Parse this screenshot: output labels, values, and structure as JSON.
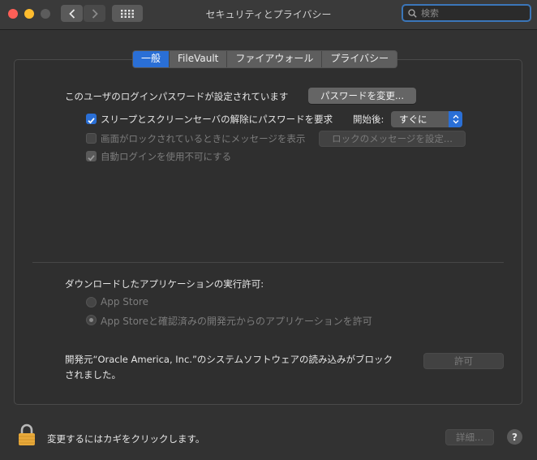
{
  "window": {
    "title": "セキュリティとプライバシー"
  },
  "search": {
    "placeholder": "検索"
  },
  "tabs": [
    {
      "label": "一般",
      "active": true
    },
    {
      "label": "FileVault",
      "active": false
    },
    {
      "label": "ファイアウォール",
      "active": false
    },
    {
      "label": "プライバシー",
      "active": false
    }
  ],
  "general": {
    "password_text": "このユーザのログインパスワードが設定されています",
    "change_password_button": "パスワードを変更...",
    "require_password_label": "スリープとスクリーンセーバの解除にパスワードを要求",
    "start_after_label": "開始後:",
    "start_after_value": "すぐに",
    "lock_message_label": "画面がロックされているときにメッセージを表示",
    "lock_message_button": "ロックのメッセージを設定...",
    "disable_autologin_label": "自動ログインを使用不可にする"
  },
  "downloads": {
    "heading": "ダウンロードしたアプリケーションの実行許可:",
    "option_appstore": "App Store",
    "option_appstore_identified": "App Storeと確認済みの開発元からのアプリケーションを許可",
    "blocked_line1": "開発元“Oracle America, Inc.”のシステムソフトウェアの読み込みがブロック",
    "blocked_line2": "されました。",
    "allow_button": "許可"
  },
  "footer": {
    "lock_text": "変更するにはカギをクリックします。",
    "advanced_button": "詳細...",
    "help_label": "?"
  },
  "colors": {
    "accent": "#2a6fd6",
    "background": "#323232",
    "lock": "#e8a93a"
  }
}
